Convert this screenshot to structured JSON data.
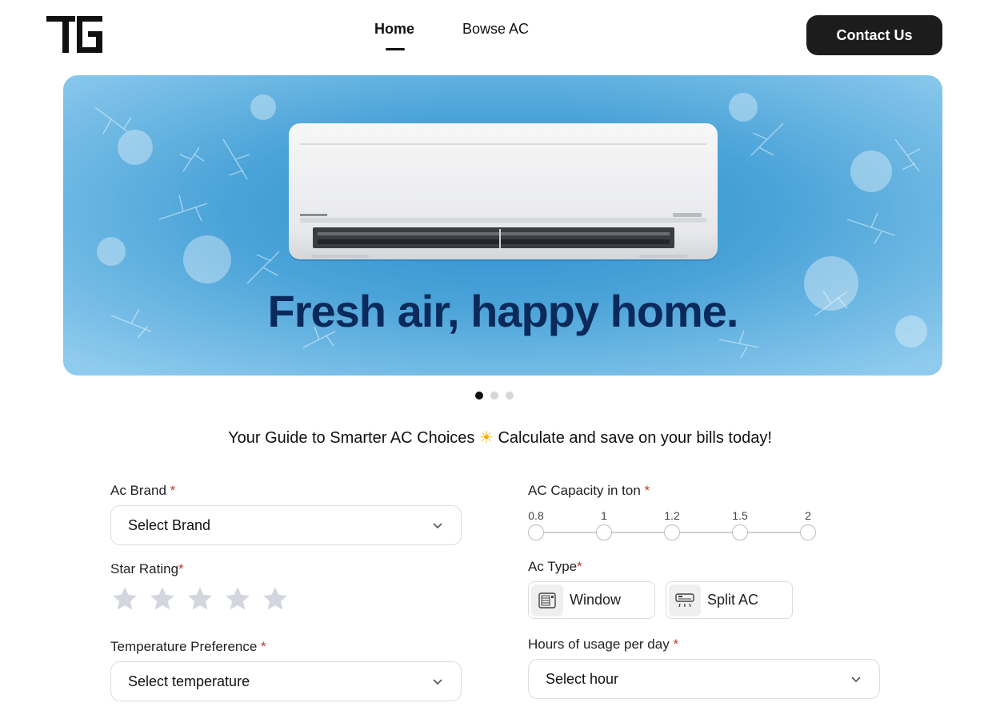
{
  "header": {
    "nav": [
      {
        "label": "Home",
        "active": true
      },
      {
        "label": "Bowse AC",
        "active": false
      }
    ],
    "contact_label": "Contact Us"
  },
  "hero": {
    "title": "Fresh air, happy home.",
    "slides_total": 3,
    "active_slide": 1
  },
  "tagline": {
    "text_before": "Your Guide to Smarter AC Choices ",
    "emoji": "☀",
    "text_after": " Calculate and save on your bills today!"
  },
  "form": {
    "brand": {
      "label": "Ac Brand ",
      "required_mark": "*",
      "value": "Select Brand"
    },
    "star_rating": {
      "label": "Star Rating",
      "required_mark": "*",
      "max": 5,
      "selected": 0
    },
    "temperature": {
      "label": "Temperature Preference ",
      "required_mark": "*",
      "value": "Select temperature"
    },
    "capacity": {
      "label": "AC Capacity in ton ",
      "required_mark": "*",
      "options": [
        "0.8",
        "1",
        "1.2",
        "1.5",
        "2"
      ],
      "selected": null
    },
    "ac_type": {
      "label": "Ac Type",
      "required_mark": "*",
      "options": [
        {
          "label": "Window",
          "icon": "window-ac-icon"
        },
        {
          "label": "Split AC",
          "icon": "split-ac-icon"
        }
      ]
    },
    "hours": {
      "label": "Hours of usage per day ",
      "required_mark": "*",
      "value": "Select hour"
    }
  },
  "colors": {
    "brand_dark": "#1c1c1c",
    "hero_title": "#0b2a5c",
    "required": "#c0392b",
    "star_inactive": "#d3d6de",
    "ice_blue": "#4aa3d8"
  }
}
